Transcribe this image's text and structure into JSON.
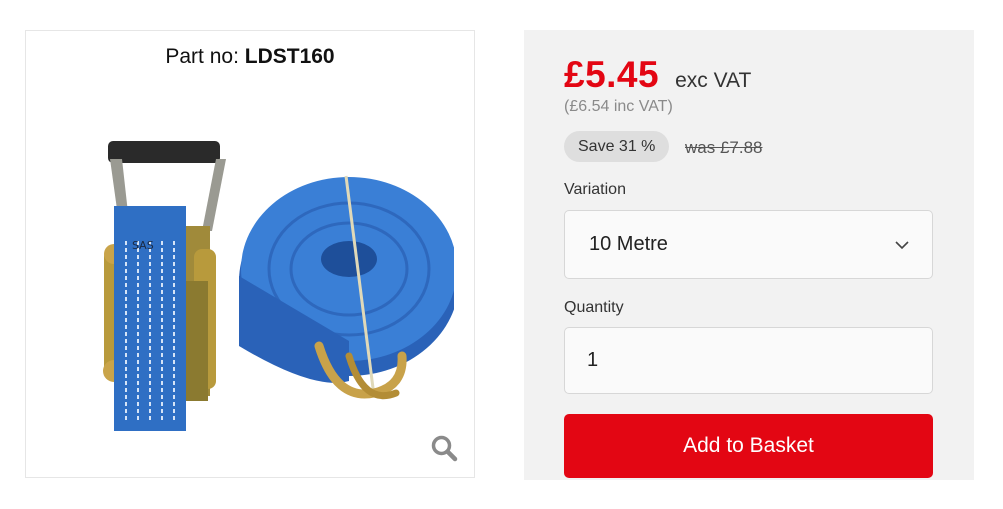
{
  "product": {
    "part_no_label": "Part no:",
    "part_no": "LDST160",
    "image_alt": "Blue ratchet strap with J hooks",
    "zoom_icon": "magnifier-icon"
  },
  "pricing": {
    "price": "£5.45",
    "exc_vat_label": "exc VAT",
    "inc_vat": "(£6.54 inc VAT)",
    "save_badge": "Save 31 %",
    "was_price": "was £7.88"
  },
  "variation": {
    "label": "Variation",
    "selected": "10 Metre",
    "icon": "chevron-down-icon"
  },
  "quantity": {
    "label": "Quantity",
    "value": "1"
  },
  "actions": {
    "add_to_basket": "Add to Basket"
  },
  "colors": {
    "accent_red": "#e30613",
    "panel_bg": "#f2f2f2",
    "strap_blue": "#2f6fc4"
  }
}
